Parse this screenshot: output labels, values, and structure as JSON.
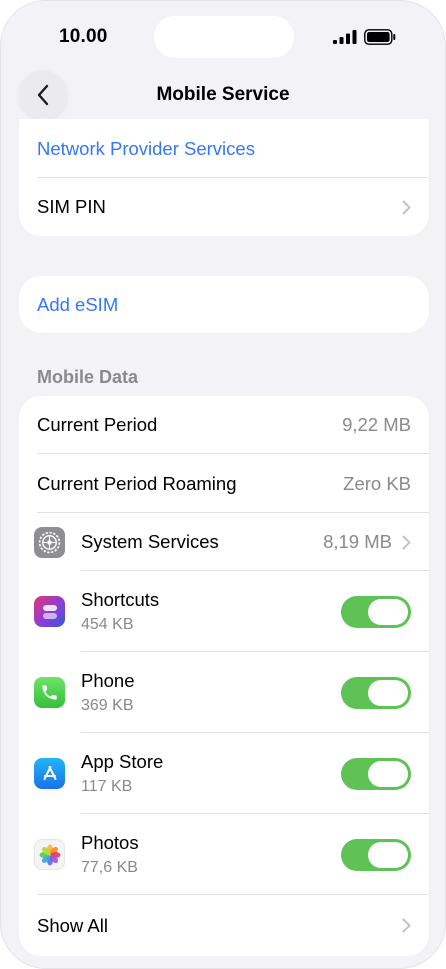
{
  "status_bar": {
    "time": "10.00"
  },
  "nav": {
    "title": "Mobile Service"
  },
  "group1": {
    "network_provider_services": "Network Provider Services",
    "sim_pin": "SIM PIN"
  },
  "group2": {
    "add_esim": "Add eSIM"
  },
  "mobile_data": {
    "header": "Mobile Data",
    "current_period": {
      "label": "Current Period",
      "value": "9,22 MB"
    },
    "current_period_roaming": {
      "label": "Current Period Roaming",
      "value": "Zero KB"
    },
    "system_services": {
      "label": "System Services",
      "value": "8,19 MB"
    },
    "apps": [
      {
        "name": "Shortcuts",
        "usage": "454 KB",
        "icon": "shortcuts-icon",
        "enabled": true
      },
      {
        "name": "Phone",
        "usage": "369 KB",
        "icon": "phone-icon",
        "enabled": true
      },
      {
        "name": "App Store",
        "usage": "117 KB",
        "icon": "app-store-icon",
        "enabled": true
      },
      {
        "name": "Photos",
        "usage": "77,6 KB",
        "icon": "photos-icon",
        "enabled": true
      }
    ],
    "show_all": "Show All"
  },
  "colors": {
    "link": "#3478f6",
    "toggle_on": "#5ec255",
    "background": "#f2f2f7",
    "secondary_text": "#8a8a8e"
  }
}
